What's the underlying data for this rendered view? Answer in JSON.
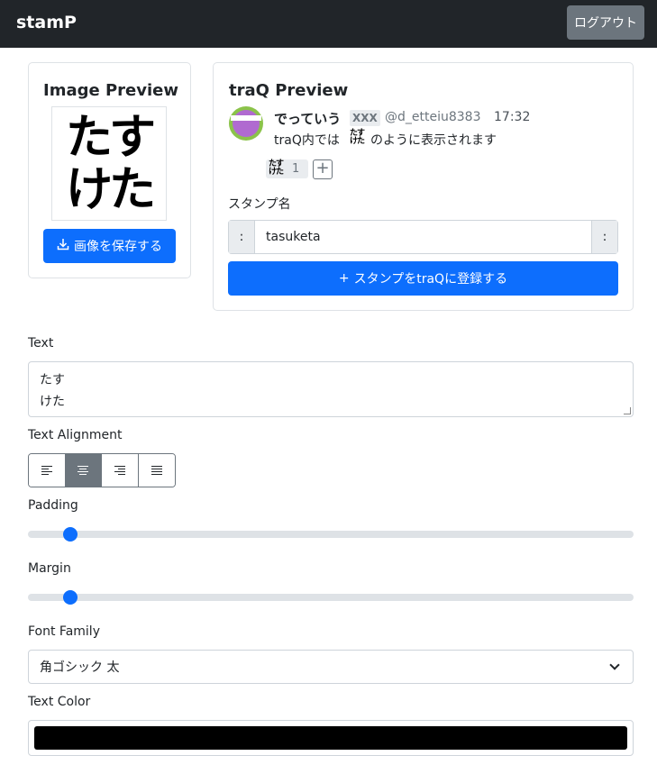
{
  "navbar": {
    "brand": "stamP",
    "logout_label": "ログアウト"
  },
  "image_preview": {
    "title": "Image Preview",
    "stamp_lines": [
      "たす",
      "けた"
    ],
    "save_label": "画像を保存する"
  },
  "traq_preview": {
    "title": "traQ Preview",
    "message": {
      "user": "でっていう",
      "badge": "XXX",
      "user_id": "@d_etteiu8383",
      "time": "17:32",
      "text_before": "traQ内では",
      "text_after": "のように表示されます",
      "stamp_small": [
        "たす",
        "けた"
      ],
      "reaction_count": "1",
      "add_reaction": "+"
    },
    "stamp_name_label": "スタンプ名",
    "prefix": ":",
    "suffix": ":",
    "stamp_name_value": "tasuketa",
    "register_label": "スタンプをtraQに登録する",
    "register_icon": "+"
  },
  "form": {
    "text_label": "Text",
    "text_lines": [
      "たす",
      "けた"
    ],
    "alignment_label": "Text Alignment",
    "alignment_options": [
      "left",
      "center",
      "right",
      "justify"
    ],
    "alignment_selected": "center",
    "padding_label": "Padding",
    "padding_value": 0.06,
    "margin_label": "Margin",
    "margin_value": 0.06,
    "font_label": "Font Family",
    "font_value": "角ゴシック 太",
    "color_label": "Text Color",
    "color_value": "#000000"
  },
  "colors": {
    "navbar": "#212529",
    "primary": "#0d6efd",
    "secondary": "#6c757d"
  },
  "icons": {
    "save": "download-icon",
    "register": "plus-icon",
    "select": "chevron-down-icon"
  }
}
